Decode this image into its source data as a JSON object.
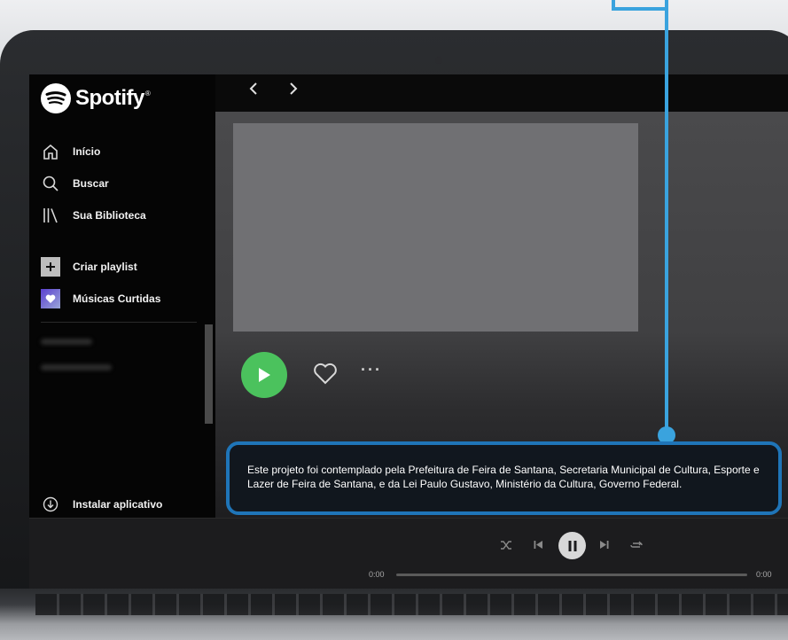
{
  "app": {
    "name": "Spotify",
    "reg_mark": "®"
  },
  "sidebar": {
    "nav": [
      {
        "label": "Início",
        "icon": "home-icon"
      },
      {
        "label": "Buscar",
        "icon": "search-icon"
      },
      {
        "label": "Sua Biblioteca",
        "icon": "library-icon"
      }
    ],
    "actions": [
      {
        "label": "Criar playlist",
        "icon": "plus-icon"
      },
      {
        "label": "Músicas Curtidas",
        "icon": "liked-heart-icon"
      }
    ],
    "install_label": "Instalar aplicativo"
  },
  "topbar": {
    "back_icon": "chevron-left-icon",
    "forward_icon": "chevron-right-icon"
  },
  "album": {
    "more_label": "···"
  },
  "callout": {
    "text": "Este projeto foi contemplado pela Prefeitura de Feira de Santana, Secretaria Municipal de Cultura, Esporte e Lazer de Feira de Santana,  e da Lei Paulo Gustavo, Ministério da Cultura, Governo Federal."
  },
  "player": {
    "current_time": "0:00",
    "total_time": "0:00",
    "progress": 0,
    "state": "playing"
  },
  "colors": {
    "accent_green": "#4bc25d",
    "callout_border": "#1f75b8",
    "connector": "#3aa3de"
  }
}
